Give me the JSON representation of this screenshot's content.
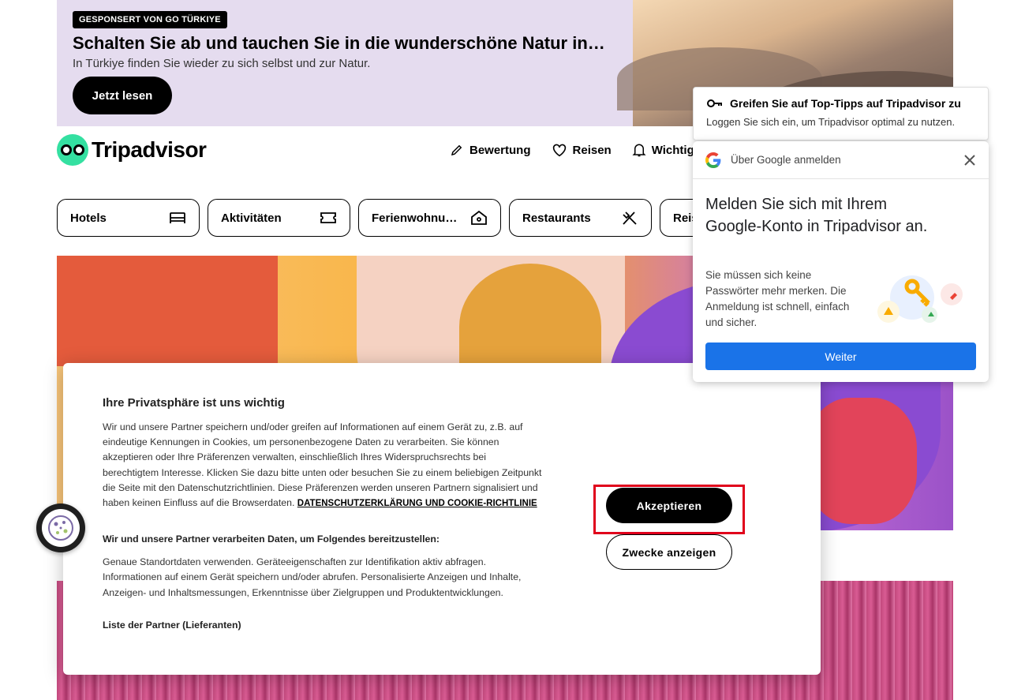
{
  "ad": {
    "sponsor": "GESPONSERT VON GO TÜRKIYE",
    "title": "Schalten Sie ab und tauchen Sie in die wunderschöne Natur in…",
    "subtitle": "In Türkiye finden Sie wieder zu sich selbst und zur Natur.",
    "cta": "Jetzt lesen"
  },
  "header": {
    "logo": "Tripadvisor",
    "nav": [
      {
        "label": "Bewertung",
        "icon": "pencil-icon"
      },
      {
        "label": "Reisen",
        "icon": "heart-icon"
      },
      {
        "label": "Wichtig",
        "icon": "bell-icon"
      }
    ]
  },
  "categories": [
    {
      "label": "Hotels",
      "icon": "bed-icon"
    },
    {
      "label": "Aktivitäten",
      "icon": "ticket-icon"
    },
    {
      "label": "Ferienwohnu…",
      "icon": "house-icon"
    },
    {
      "label": "Restaurants",
      "icon": "cutlery-icon"
    },
    {
      "label": "Reis",
      "icon": ""
    }
  ],
  "cookie": {
    "title": "Ihre Privatsphäre ist uns wichtig",
    "body": "Wir und unsere Partner speichern und/oder greifen auf Informationen auf einem Gerät zu, z.B. auf eindeutige Kennungen in Cookies, um personenbezogene Daten zu verarbeiten. Sie können akzeptieren oder Ihre Präferenzen verwalten, einschließlich Ihres Widerspruchsrechts bei berechtigtem Interesse. Klicken Sie dazu bitte unten oder besuchen Sie zu einem beliebigen Zeitpunkt die Seite mit den Datenschutzrichtlinien. Diese Präferenzen werden unseren Partnern signalisiert und haben keinen Einfluss auf die Browserdaten.",
    "link": "DATENSCHUTZERKLÄRUNG UND COOKIE-RICHTLINIE",
    "subheading": "Wir und unsere Partner verarbeiten Daten, um Folgendes bereitzustellen:",
    "purposes": "Genaue Standortdaten verwenden. Geräteeigenschaften zur Identifikation aktiv abfragen. Informationen auf einem Gerät speichern und/oder abrufen. Personalisierte Anzeigen und Inhalte, Anzeigen- und Inhaltsmessungen, Erkenntnisse über Zielgruppen und Produktentwicklungen.",
    "partners": "Liste der Partner (Lieferanten)",
    "accept": "Akzeptieren",
    "purposes_button": "Zwecke anzeigen"
  },
  "tip": {
    "title": "Greifen Sie auf Top-Tipps auf Tripadvisor zu",
    "text": "Loggen Sie sich ein, um Tripadvisor optimal zu nutzen."
  },
  "google": {
    "header": "Über Google anmelden",
    "title": "Melden Sie sich mit Ihrem Google-Konto in Tripadvisor an.",
    "desc": "Sie müssen sich keine Passwörter mehr merken. Die Anmeldung ist schnell, einfach und sicher.",
    "continue": "Weiter"
  },
  "colors": {
    "brand_green": "#34e0a1",
    "accept_highlight": "#e0001b",
    "google_blue": "#1a73e8"
  }
}
